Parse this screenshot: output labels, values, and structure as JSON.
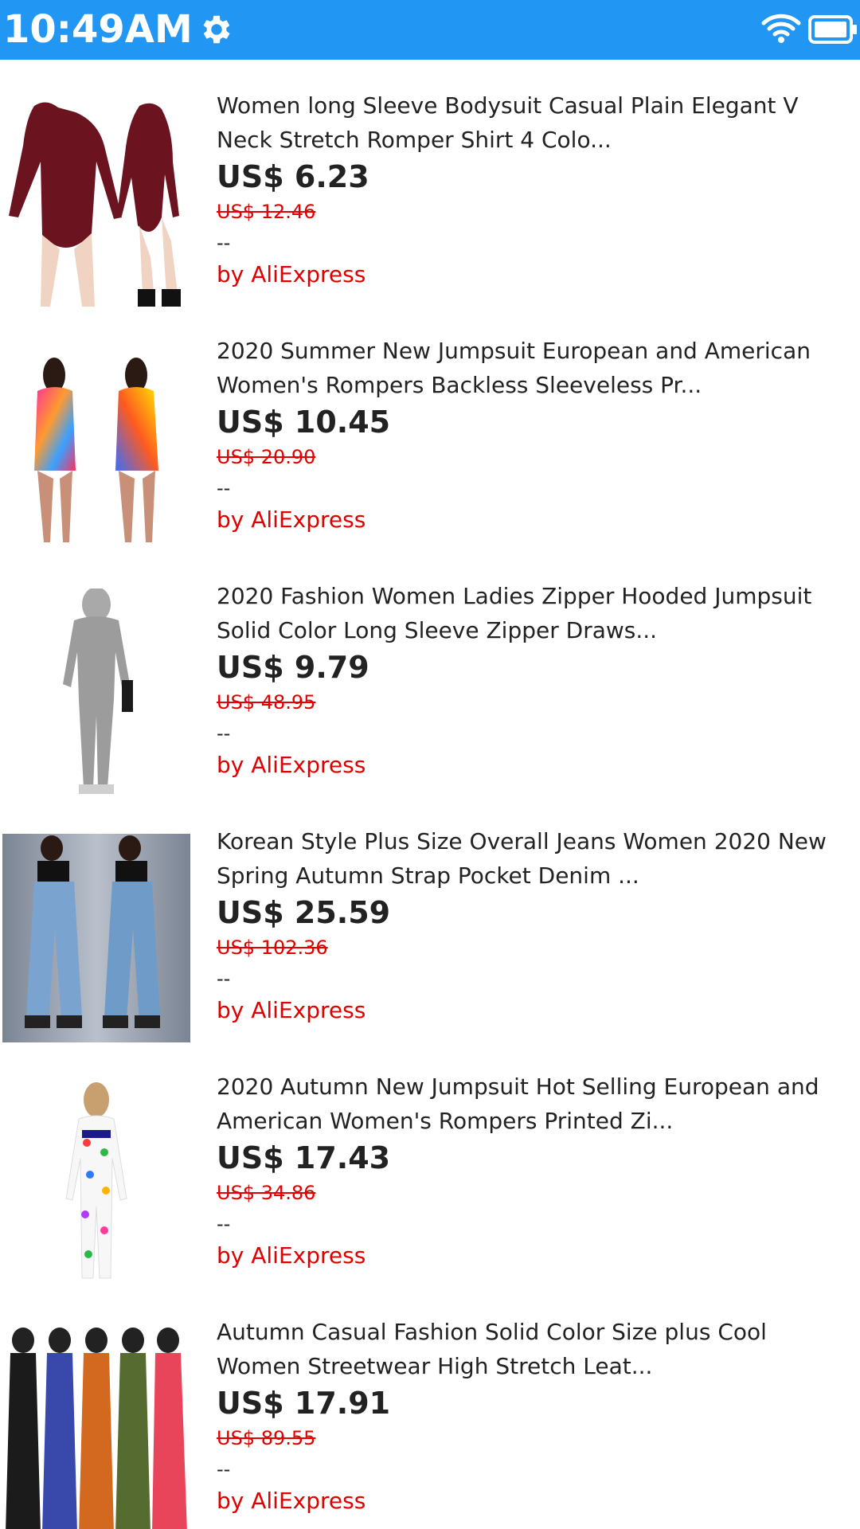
{
  "status_bar": {
    "time": "10:49AM",
    "bg_color": "#2196F3",
    "icons": [
      "gear-icon",
      "wifi-icon",
      "battery-icon"
    ]
  },
  "accent": {
    "price_strike_color": "#e00000",
    "seller_color": "#e00000"
  },
  "products": [
    {
      "title": "Women long Sleeve Bodysuit Casual Plain Elegant V Neck Stretch Romper Shirt 4 Colo...",
      "price": "US$ 6.23",
      "old_price": "US$ 12.46",
      "rating": "--",
      "seller": "by AliExpress"
    },
    {
      "title": "2020 Summer New Jumpsuit European and American Women's Rompers Backless Sleeveless Pr...",
      "price": "US$ 10.45",
      "old_price": "US$ 20.90",
      "rating": "--",
      "seller": "by AliExpress"
    },
    {
      "title": "2020 Fashion Women Ladies Zipper Hooded Jumpsuit Solid Color Long Sleeve Zipper Draws...",
      "price": "US$ 9.79",
      "old_price": "US$ 48.95",
      "rating": "--",
      "seller": "by AliExpress"
    },
    {
      "title": "Korean Style Plus Size Overall Jeans Women 2020 New Spring Autumn Strap Pocket Denim ...",
      "price": "US$ 25.59",
      "old_price": "US$ 102.36",
      "rating": "--",
      "seller": "by AliExpress"
    },
    {
      "title": "2020 Autumn New Jumpsuit Hot Selling European and American Women's Rompers Printed Zi...",
      "price": "US$ 17.43",
      "old_price": "US$ 34.86",
      "rating": "--",
      "seller": "by AliExpress"
    },
    {
      "title": "Autumn Casual Fashion Solid Color Size plus Cool Women Streetwear High Stretch Leat...",
      "price": "US$ 17.91",
      "old_price": "US$ 89.55",
      "rating": "--",
      "seller": "by AliExpress"
    }
  ]
}
